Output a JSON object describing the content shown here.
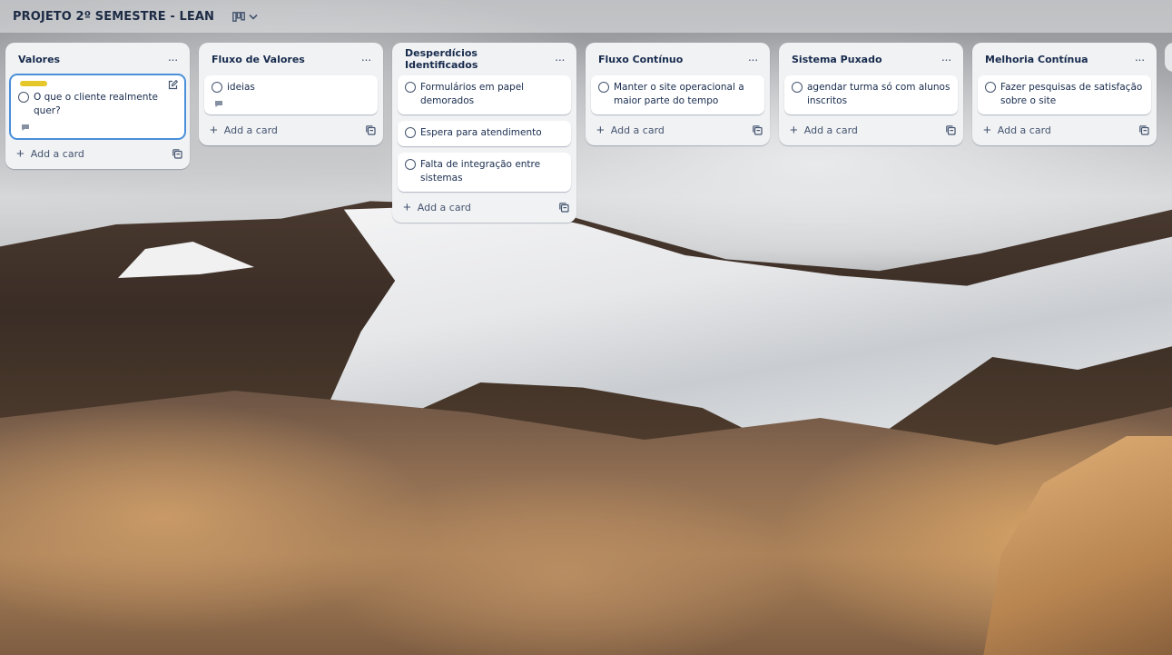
{
  "board": {
    "title": "PROJETO 2º SEMESTRE - LEAN",
    "view_icon": "board-view-icon",
    "view_dropdown_icon": "chevron-down-icon"
  },
  "lists": [
    {
      "title": "Valores",
      "menu": "···",
      "cards": [
        {
          "text": "O que o cliente realmente quer?",
          "label_color": "#e5c72a",
          "has_description": true,
          "focused": true
        }
      ],
      "add_card": "Add a card"
    },
    {
      "title": "Fluxo de Valores",
      "menu": "···",
      "cards": [
        {
          "text": "ideias",
          "has_description": true
        }
      ],
      "add_card": "Add a card"
    },
    {
      "title": "Desperdícios Identificados",
      "menu": "···",
      "cards": [
        {
          "text": "Formulários em papel demorados"
        },
        {
          "text": "Espera para atendimento"
        },
        {
          "text": "Falta de integração entre sistemas"
        }
      ],
      "add_card": "Add a card"
    },
    {
      "title": "Fluxo Contínuo",
      "menu": "···",
      "cards": [
        {
          "text": "Manter o site operacional a maior parte do tempo"
        }
      ],
      "add_card": "Add a card"
    },
    {
      "title": "Sistema Puxado",
      "menu": "···",
      "cards": [
        {
          "text": "agendar turma só com alunos inscritos"
        }
      ],
      "add_card": "Add a card"
    },
    {
      "title": "Melhoria Contínua",
      "menu": "···",
      "cards": [
        {
          "text": "Fazer pesquisas de satisfação sobre o site"
        }
      ],
      "add_card": "Add a card"
    }
  ],
  "colors": {
    "list_bg": "#f1f2f4",
    "card_bg": "#ffffff",
    "focus_ring": "#4a8fd9",
    "label_yellow": "#e5c72a",
    "text_primary": "#172b4d",
    "text_subtle": "#44546f"
  }
}
